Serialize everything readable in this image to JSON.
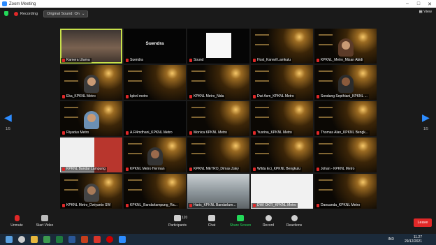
{
  "window": {
    "title": "Zoom Meeting"
  },
  "topbar": {
    "recording_label": "Recording",
    "sound_label": "Original Sound: On",
    "view_label": "View"
  },
  "pagination": {
    "left": "1/5",
    "right": "1/5"
  },
  "tiles": [
    {
      "name": "Kamera Utama",
      "big": ""
    },
    {
      "name": "Suendra",
      "big": "Suendra"
    },
    {
      "name": "Sound",
      "big": ""
    },
    {
      "name": "Host_Kanwil Lamkulu",
      "big": ""
    },
    {
      "name": "KPKNL_Metro_Mizan Abidi",
      "big": ""
    },
    {
      "name": "Eka_KPKNL Metro",
      "big": ""
    },
    {
      "name": "kpknl metro",
      "big": ""
    },
    {
      "name": "KPKNL Metro_Nida",
      "big": ""
    },
    {
      "name": "Dwi Asm_KPKNL Metro",
      "big": ""
    },
    {
      "name": "Sondang Septhiani_KPKNL ...",
      "big": ""
    },
    {
      "name": "Riyadus Metro",
      "big": ""
    },
    {
      "name": "A.R4mdhani_KPKNL Metro",
      "big": ""
    },
    {
      "name": "Monica KPKNL Metro",
      "big": ""
    },
    {
      "name": "Yusrina_KPKNL Metro",
      "big": ""
    },
    {
      "name": "Thomas Alan_KPKNL Bengk...",
      "big": ""
    },
    {
      "name": "KPKNL Bandar Lampung",
      "big": ""
    },
    {
      "name": "KPKNL Metro Herman",
      "big": ""
    },
    {
      "name": "KPKNL METRO_Dimas Zaky",
      "big": ""
    },
    {
      "name": "Wilda Eci_KPKNL Bengkulu",
      "big": ""
    },
    {
      "name": "Johan - KPKNL Metro",
      "big": ""
    },
    {
      "name": "KPKNL Metro_Dwiyanto SW",
      "big": ""
    },
    {
      "name": "KPKNL_Bandarlampung_Ra...",
      "big": ""
    },
    {
      "name": "Haris_KPKNL Bandarlam...",
      "big": ""
    },
    {
      "name": "DWI OKTI_KPKNL Metro",
      "big": ""
    },
    {
      "name": "Danuanda_KPKNL Metro",
      "big": ""
    }
  ],
  "toolbar": {
    "unmute": "Unmute",
    "start_video": "Start Video",
    "participants": "Participants",
    "participants_count": "120",
    "chat": "Chat",
    "share": "Share Screen",
    "record": "Record",
    "reactions": "Reactions",
    "leave": "Leave"
  },
  "taskbar": {
    "lang": "IND",
    "time": "11.27",
    "date": "29/12/2021"
  },
  "colors": {
    "accent": "#2d8cff",
    "active_speaker": "#c7e04a",
    "leave": "#e02828",
    "share": "#23d959"
  }
}
